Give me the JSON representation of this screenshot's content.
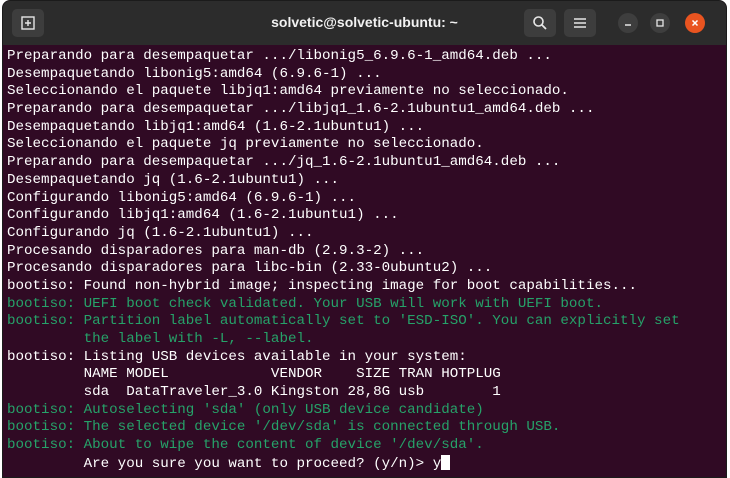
{
  "window": {
    "title": "solvetic@solvetic-ubuntu: ~"
  },
  "toolbar": {
    "new_tab_icon": "new-tab-icon",
    "search_icon": "search-icon",
    "menu_icon": "hamburger-menu-icon",
    "minimize_icon": "minimize-icon",
    "maximize_icon": "maximize-icon",
    "close_icon": "close-icon"
  },
  "colors": {
    "background": "#300a24",
    "text": "#ffffff",
    "green": "#26a269",
    "close": "#e95420"
  },
  "terminal": {
    "lines": [
      "Preparando para desempaquetar .../libonig5_6.9.6-1_amd64.deb ...",
      "Desempaquetando libonig5:amd64 (6.9.6-1) ...",
      "Seleccionando el paquete libjq1:amd64 previamente no seleccionado.",
      "Preparando para desempaquetar .../libjq1_1.6-2.1ubuntu1_amd64.deb ...",
      "Desempaquetando libjq1:amd64 (1.6-2.1ubuntu1) ...",
      "Seleccionando el paquete jq previamente no seleccionado.",
      "Preparando para desempaquetar .../jq_1.6-2.1ubuntu1_amd64.deb ...",
      "Desempaquetando jq (1.6-2.1ubuntu1) ...",
      "Configurando libonig5:amd64 (6.9.6-1) ...",
      "Configurando libjq1:amd64 (1.6-2.1ubuntu1) ...",
      "Configurando jq (1.6-2.1ubuntu1) ...",
      "Procesando disparadores para man-db (2.9.3-2) ...",
      "Procesando disparadores para libc-bin (2.33-0ubuntu2) ...",
      "bootiso: Found non-hybrid image; inspecting image for boot capabilities...",
      "bootiso: UEFI boot check validated. Your USB will work with UEFI boot.",
      "bootiso: Partition label automatically set to 'ESD-ISO'. You can explicitly set",
      "         the label with -L, --label.",
      "bootiso: Listing USB devices available in your system:",
      "         NAME MODEL            VENDOR    SIZE TRAN HOTPLUG",
      "         sda  DataTraveler_3.0 Kingston 28,8G usb        1",
      "bootiso: Autoselecting 'sda' (only USB device candidate)",
      "bootiso: The selected device '/dev/sda' is connected through USB.",
      "bootiso: About to wipe the content of device '/dev/sda'.",
      "         Are you sure you want to proceed? (y/n)> y"
    ]
  }
}
